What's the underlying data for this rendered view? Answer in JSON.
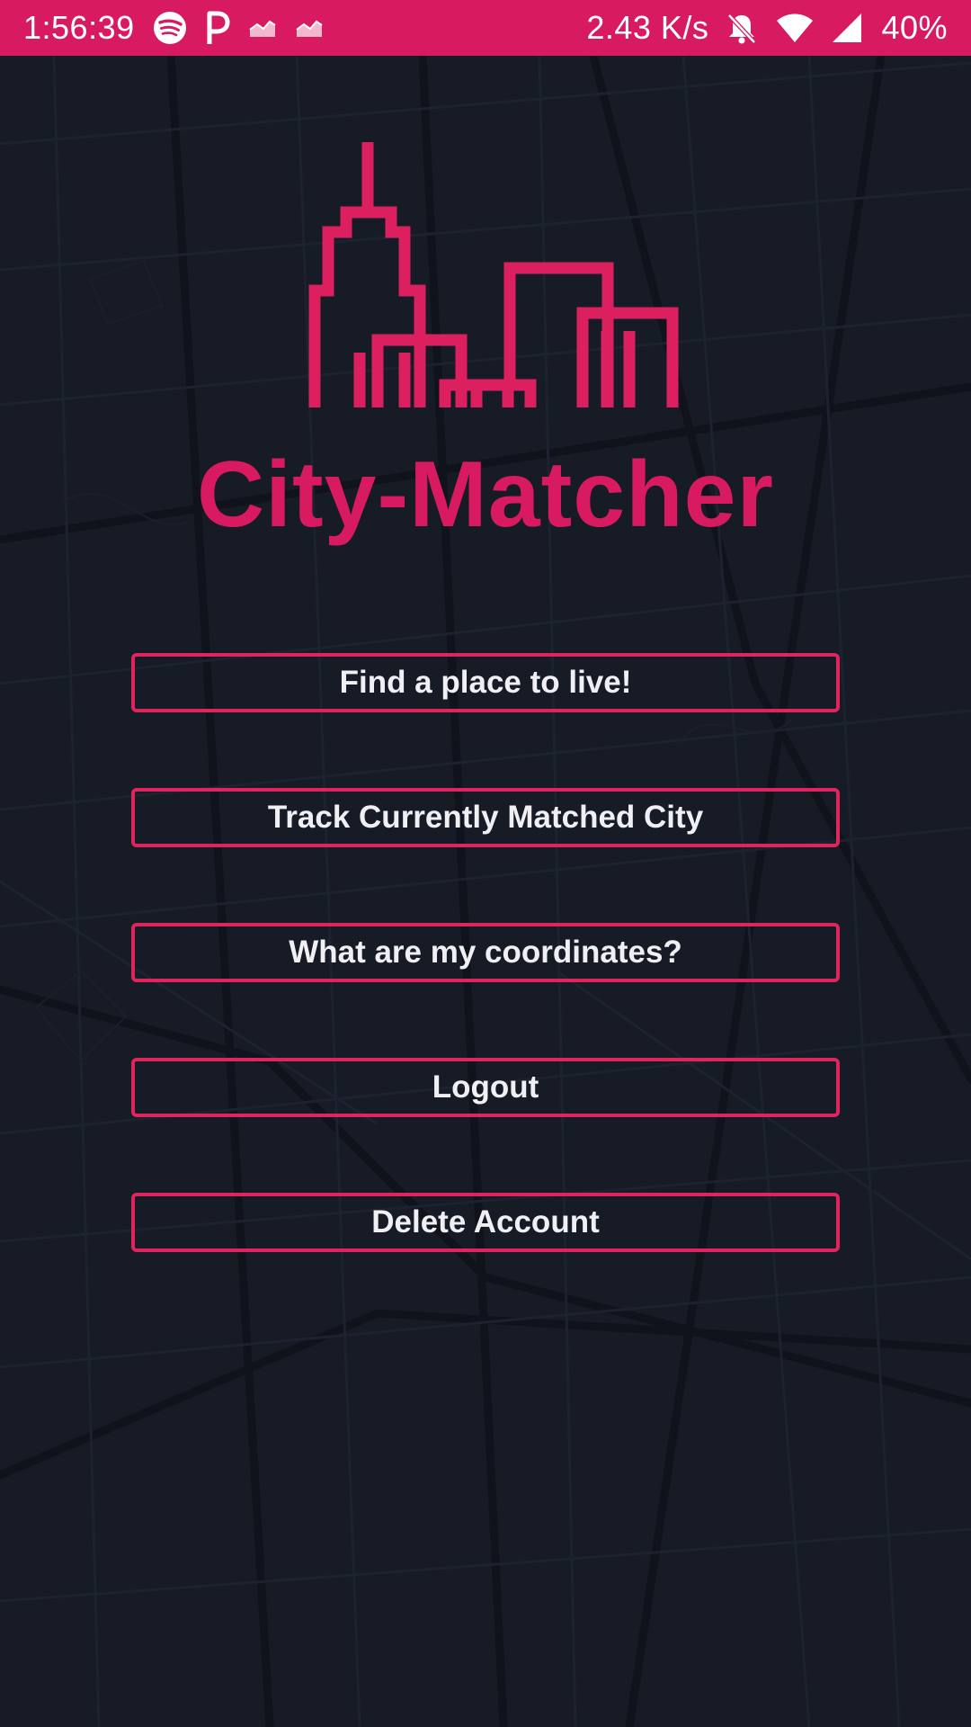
{
  "status_bar": {
    "time": "1:56:39",
    "network_speed": "2.43 K/s",
    "battery": "40%",
    "icons_left": [
      "spotify-icon",
      "p-icon",
      "chart-icon",
      "chart-icon"
    ],
    "icons_right": [
      "bell-off-icon",
      "wifi-icon",
      "signal-icon"
    ],
    "color": "#d81b60"
  },
  "app": {
    "title": "City-Matcher",
    "logo": "city-skyline-logo",
    "accent_color": "#d81b60",
    "background_color": "#171b26"
  },
  "menu": {
    "find_place": "Find a place to live!",
    "track_city": "Track Currently Matched City",
    "coordinates": "What are my coordinates?",
    "logout": "Logout",
    "delete_account": "Delete Account"
  }
}
